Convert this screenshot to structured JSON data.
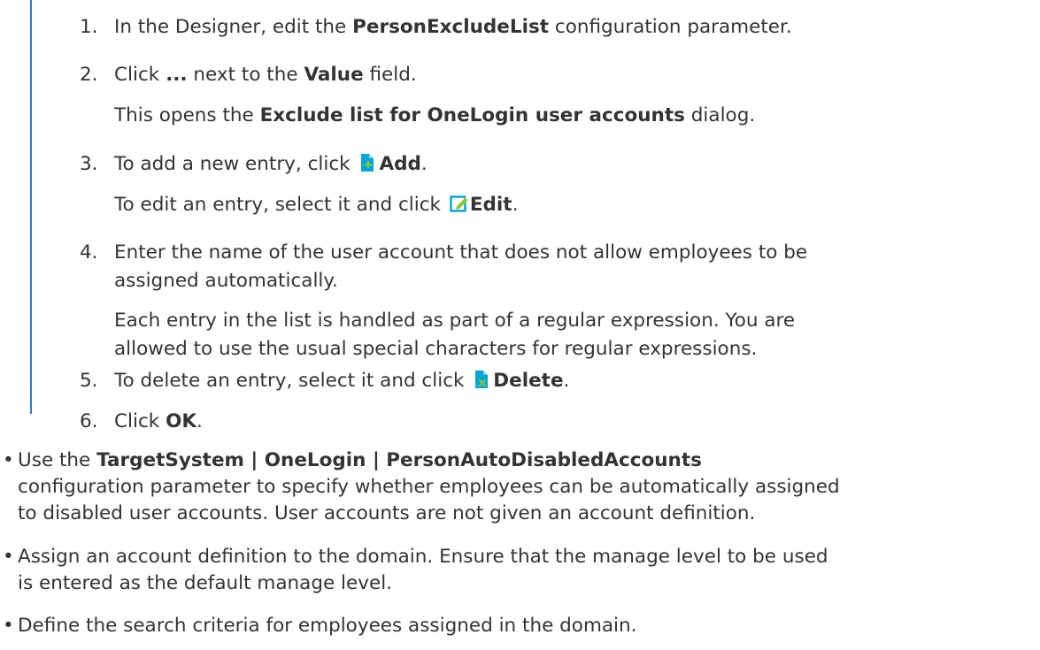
{
  "steps": [
    {
      "num": "1.",
      "pre": "In the Designer, edit the ",
      "bold": "PersonExcludeList",
      "post": " configuration parameter."
    },
    {
      "num": "2.",
      "pre": "Click ",
      "bold": "...",
      "mid": " next to the ",
      "bold2": "Value",
      "post": " field."
    },
    {
      "sub_pre": "This opens the ",
      "sub_bold": "Exclude list for OneLogin user accounts",
      "sub_post": " dialog."
    },
    {
      "num": "3.",
      "pre": "To add a new entry, click ",
      "icon": "add-icon",
      "bold": "Add",
      "post": "."
    },
    {
      "sub_pre": "To edit an entry, select it and click ",
      "sub_icon": "edit-icon",
      "sub_bold": "Edit",
      "sub_post": "."
    },
    {
      "num": "4.",
      "line1": "Enter the name of the user account that does not allow employees to be",
      "line2": "assigned automatically."
    },
    {
      "sub1": "Each entry in the list is handled as part of a regular expression. You are",
      "sub2": "allowed to use the usual special characters for regular expressions."
    },
    {
      "num": "5.",
      "pre": "To delete an entry, select it and click ",
      "icon": "delete-icon",
      "bold": "Delete",
      "post": "."
    },
    {
      "num": "6.",
      "pre": "Click ",
      "bold": "OK",
      "post": "."
    }
  ],
  "bullets": [
    {
      "pre": "Use the ",
      "bold": "TargetSystem | OneLogin | PersonAutoDisabledAccounts",
      "line2": "configuration parameter to specify whether employees can be automatically assigned",
      "line3": "to disabled user accounts. User accounts are not given an account definition."
    },
    {
      "line1": "Assign an account definition to the domain. Ensure that the manage level to be used",
      "line2": "is entered as the default manage level."
    },
    {
      "line1": "Define the search criteria for employees assigned in the domain."
    }
  ],
  "bullet_glyph": "•",
  "colors": {
    "text": "#333333",
    "rule": "#2f7fc1",
    "icon_add": "#00a6d6",
    "icon_add_plus": "#8dc63f",
    "icon_edit": "#00a6d6",
    "icon_delete": "#00a6d6",
    "icon_delete_x": "#8dc63f"
  }
}
